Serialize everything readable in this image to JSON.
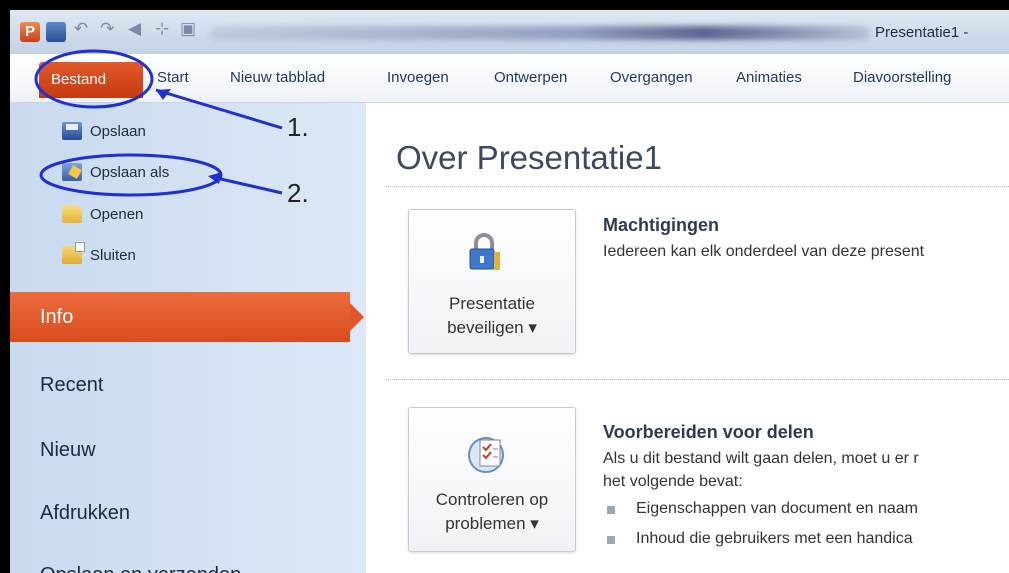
{
  "titlebar": {
    "logo_letter": "P",
    "window_title": "Presentatie1 -"
  },
  "ribbon": {
    "tabs": [
      "Bestand",
      "Start",
      "Nieuw tabblad",
      "Invoegen",
      "Ontwerpen",
      "Overgangen",
      "Animaties",
      "Diavoorstelling"
    ]
  },
  "sidebar": {
    "commands": [
      "Opslaan",
      "Opslaan als",
      "Openen",
      "Sluiten"
    ],
    "nav": [
      "Info",
      "Recent",
      "Nieuw",
      "Afdrukken",
      "Opslaan en verzenden"
    ]
  },
  "main": {
    "title": "Over Presentatie1",
    "sections": [
      {
        "button_lines": [
          "Presentatie",
          "beveiligen ▾"
        ],
        "heading": "Machtigingen",
        "text": [
          "Iedereen kan elk onderdeel van deze present"
        ]
      },
      {
        "button_lines": [
          "Controleren op",
          "problemen ▾"
        ],
        "heading": "Voorbereiden voor delen",
        "text": [
          "Als u dit bestand wilt gaan delen, moet u er r",
          "het volgende bevat:"
        ],
        "bullets": [
          "Eigenschappen van document en naam",
          "Inhoud die gebruikers met een handica"
        ]
      }
    ]
  },
  "annotations": {
    "labels": [
      "1.",
      "2."
    ],
    "color": "#1f2fd6"
  },
  "colors": {
    "accent": "#d94c1d",
    "backstage": "#d2e1f3"
  }
}
